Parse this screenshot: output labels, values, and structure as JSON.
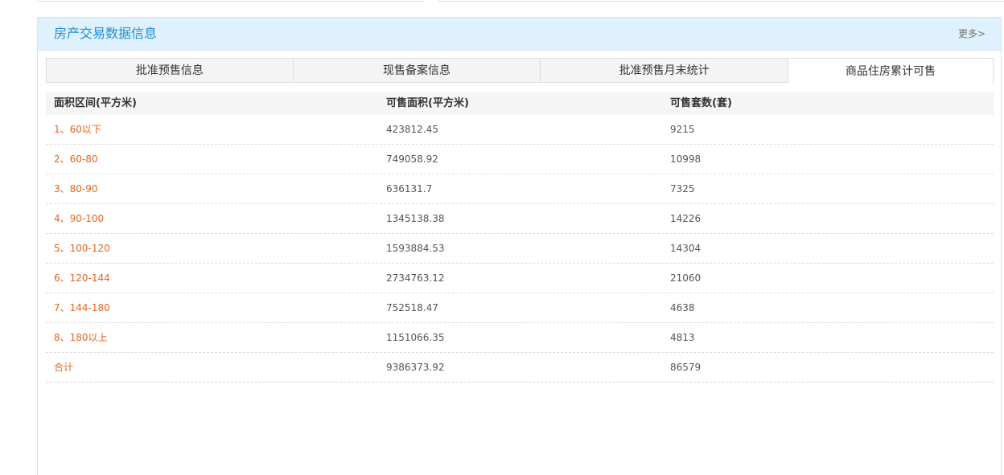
{
  "panel": {
    "title": "房产交易数据信息",
    "more_label": "更多>"
  },
  "tabs": [
    {
      "label": "批准预售信息"
    },
    {
      "label": "现售备案信息"
    },
    {
      "label": "批准预售月末统计"
    },
    {
      "label": "商品住房累计可售",
      "active": true
    }
  ],
  "table": {
    "headers": [
      "面积区间(平方米)",
      "可售面积(平方米)",
      "可售套数(套)"
    ],
    "rows": [
      [
        "1、60以下",
        "423812.45",
        "9215"
      ],
      [
        "2、60-80",
        "749058.92",
        "10998"
      ],
      [
        "3、80-90",
        "636131.7",
        "7325"
      ],
      [
        "4、90-100",
        "1345138.38",
        "14226"
      ],
      [
        "5、100-120",
        "1593884.53",
        "14304"
      ],
      [
        "6、120-144",
        "2734763.12",
        "21060"
      ],
      [
        "7、144-180",
        "752518.47",
        "4638"
      ],
      [
        "8、180以上",
        "1151066.35",
        "4813"
      ],
      [
        "合计",
        "9386373.92",
        "86579"
      ]
    ]
  },
  "colors": {
    "title": "#1e8fd6",
    "header_bg": "#dff1fc",
    "row_label": "#e8641b"
  }
}
